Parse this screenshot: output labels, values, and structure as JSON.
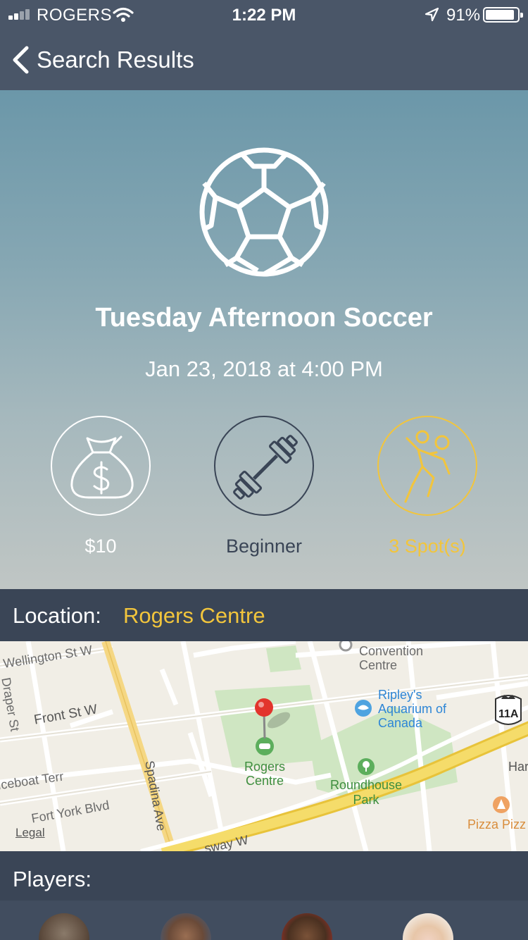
{
  "status_bar": {
    "carrier": "ROGERS",
    "time": "1:22 PM",
    "battery": "91%"
  },
  "nav": {
    "back_label": "Search Results"
  },
  "event": {
    "title": "Tuesday Afternoon Soccer",
    "datetime": "Jan 23, 2018 at 4:00 PM",
    "stats": {
      "price": "$10",
      "level": "Beginner",
      "spots": "3 Spot(s)"
    }
  },
  "location": {
    "label": "Location:",
    "value": "Rogers Centre"
  },
  "map": {
    "streets": {
      "wellington": "Wellington St W",
      "front": "Front St W",
      "draper": "Draper St",
      "iceboat": "Iceboat Terr",
      "fort_york": "Fort York Blvd",
      "spadina": "Spadina Ave",
      "expressway": "sway W",
      "har": "Har"
    },
    "places": {
      "convention": "Convention Centre",
      "ripleys": "Ripley's Aquarium of Canada",
      "rogers": "Rogers Centre",
      "roundhouse": "Roundhouse Park",
      "pizza": "Pizza Pizz"
    },
    "route_shield": "11A",
    "legal": "Legal"
  },
  "players": {
    "label": "Players:",
    "avatars": [
      "player-1",
      "player-2",
      "player-3",
      "player-4"
    ]
  },
  "colors": {
    "nav_bg": "#4a5668",
    "section_bg": "#3a4556",
    "accent_yellow": "#f2c53c"
  }
}
